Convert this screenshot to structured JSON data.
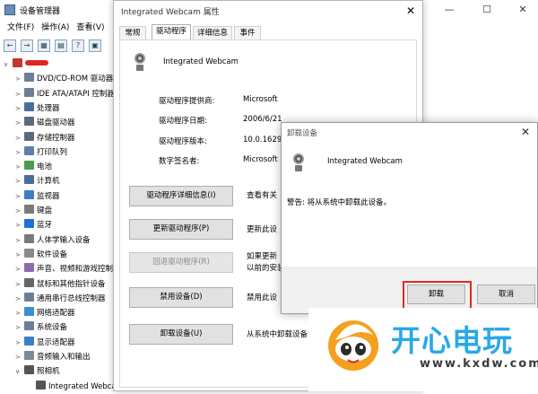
{
  "device_manager": {
    "title": "设备管理器",
    "menu": [
      "文件(F)",
      "操作(A)",
      "查看(V)"
    ],
    "toolbar": [
      "←",
      "→",
      "▦",
      "▤",
      "?",
      "▣"
    ],
    "tree": [
      {
        "label": "",
        "expander": "∨",
        "depth": 0
      },
      {
        "label": "DVD/CD-ROM 驱动器",
        "expander": ">",
        "depth": 1
      },
      {
        "label": "IDE ATA/ATAPI 控制器",
        "expander": ">",
        "depth": 1
      },
      {
        "label": "处理器",
        "expander": ">",
        "depth": 1
      },
      {
        "label": "磁盘驱动器",
        "expander": ">",
        "depth": 1
      },
      {
        "label": "存储控制器",
        "expander": ">",
        "depth": 1
      },
      {
        "label": "打印队列",
        "expander": ">",
        "depth": 1
      },
      {
        "label": "电池",
        "expander": ">",
        "depth": 1
      },
      {
        "label": "计算机",
        "expander": ">",
        "depth": 1
      },
      {
        "label": "监视器",
        "expander": ">",
        "depth": 1
      },
      {
        "label": "键盘",
        "expander": ">",
        "depth": 1
      },
      {
        "label": "蓝牙",
        "expander": ">",
        "depth": 1
      },
      {
        "label": "人体学输入设备",
        "expander": ">",
        "depth": 1
      },
      {
        "label": "软件设备",
        "expander": ">",
        "depth": 1
      },
      {
        "label": "声音、视频和游戏控制器",
        "expander": ">",
        "depth": 1
      },
      {
        "label": "鼠标和其他指针设备",
        "expander": ">",
        "depth": 1
      },
      {
        "label": "通用串行总线控制器",
        "expander": ">",
        "depth": 1
      },
      {
        "label": "网络适配器",
        "expander": ">",
        "depth": 1
      },
      {
        "label": "系统设备",
        "expander": ">",
        "depth": 1
      },
      {
        "label": "显示适配器",
        "expander": ">",
        "depth": 1
      },
      {
        "label": "音频输入和输出",
        "expander": ">",
        "depth": 1
      },
      {
        "label": "照相机",
        "expander": "∨",
        "depth": 1
      },
      {
        "label": "Integrated Webcam",
        "expander": "",
        "depth": 2
      }
    ]
  },
  "properties": {
    "title": "Integrated Webcam 属性",
    "tabs": [
      "常规",
      "驱动程序",
      "详细信息",
      "事件"
    ],
    "active_tab": 1,
    "device_name": "Integrated Webcam",
    "fields": [
      {
        "label": "驱动程序提供商:",
        "value": "Microsoft"
      },
      {
        "label": "驱动程序日期:",
        "value": "2006/6/21"
      },
      {
        "label": "驱动程序版本:",
        "value": "10.0.1629"
      },
      {
        "label": "数字签名者:",
        "value": "Microsoft"
      }
    ],
    "buttons": [
      {
        "label": "驱动程序详细信息(I)",
        "desc": [
          "查看有关",
          ""
        ],
        "enabled": true
      },
      {
        "label": "更新驱动程序(P)",
        "desc": [
          "更新此设",
          ""
        ],
        "enabled": true
      },
      {
        "label": "回退驱动程序(R)",
        "desc": [
          "如果更新",
          "以前的安装"
        ],
        "enabled": false
      },
      {
        "label": "禁用设备(D)",
        "desc": [
          "禁用此设",
          ""
        ],
        "enabled": true
      },
      {
        "label": "卸载设备(U)",
        "desc": [
          "从系统中卸载设备",
          ""
        ],
        "enabled": true
      }
    ]
  },
  "uninstall_dialog": {
    "title": "卸载设备",
    "device_name": "Integrated Webcam",
    "warning": "警告: 将从系统中卸载此设备。",
    "confirm_label": "卸载",
    "cancel_label": "取消"
  },
  "watermark": {
    "brand": "开心电玩",
    "url": "www.kxdw.com"
  },
  "colors": {
    "highlight_border": "#e0271f",
    "watermark_blue": "#2aa8e8"
  }
}
